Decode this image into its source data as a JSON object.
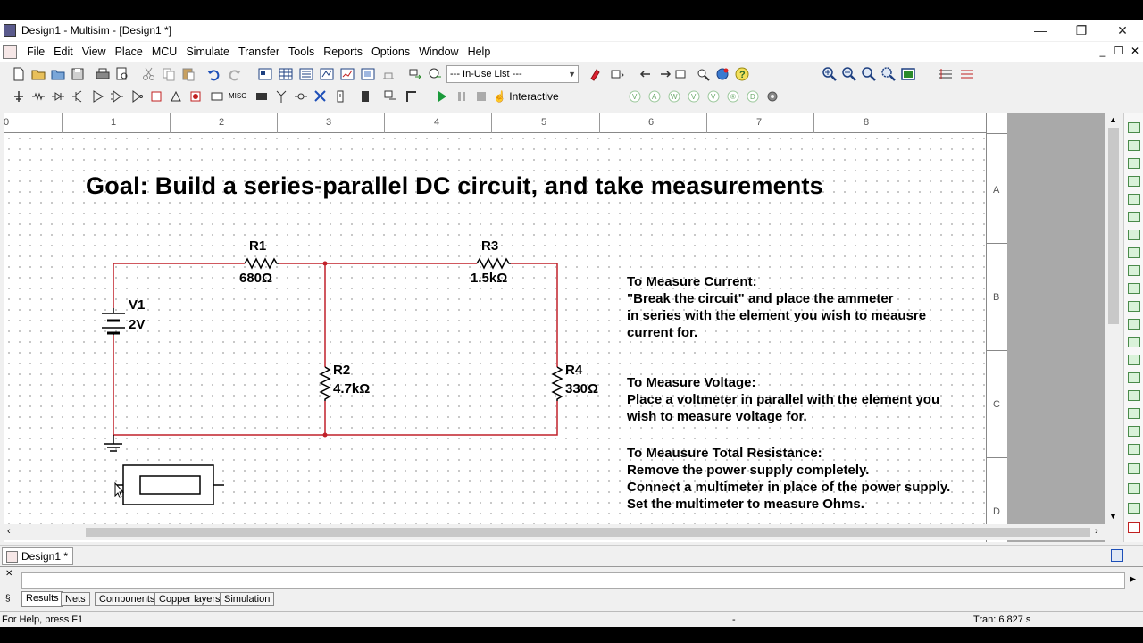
{
  "window": {
    "title": "Design1 - Multisim - [Design1 *]",
    "controls": {
      "minimize": "—",
      "restore": "❐",
      "close": "✕"
    }
  },
  "menu": {
    "items": [
      "File",
      "Edit",
      "View",
      "Place",
      "MCU",
      "Simulate",
      "Transfer",
      "Tools",
      "Reports",
      "Options",
      "Window",
      "Help"
    ],
    "mdi_controls": {
      "minimize": "_",
      "restore": "❐",
      "close": "✕"
    }
  },
  "toolbar": {
    "in_use_list": "--- In-Use List ---",
    "interactive_label": "Interactive",
    "misc_label": "MISC"
  },
  "ruler": {
    "numbers": [
      "0",
      "1",
      "2",
      "3",
      "4",
      "5",
      "6",
      "7",
      "8"
    ]
  },
  "zones": [
    "A",
    "B",
    "C",
    "D"
  ],
  "canvas": {
    "title": "Goal: Build a series-parallel DC circuit, and take measurements",
    "components": {
      "v1_name": "V1",
      "v1_value": "2V",
      "r1_name": "R1",
      "r1_value": "680Ω",
      "r2_name": "R2",
      "r2_value": "4.7kΩ",
      "r3_name": "R3",
      "r3_value": "1.5kΩ",
      "r4_name": "R4",
      "r4_value": "330Ω"
    },
    "notes": {
      "current": {
        "heading": "To Measure Current:",
        "lines": [
          "\"Break the circuit\" and place the ammeter",
          "in series with the element you wish to meausre",
          "current for."
        ]
      },
      "voltage": {
        "heading": "To Measure Voltage:",
        "lines": [
          "Place a voltmeter in parallel with the element you",
          "wish to measure voltage for."
        ]
      },
      "resistance": {
        "heading": "To Meausure Total Resistance:",
        "lines": [
          "Remove the power supply completely.",
          "Connect a multimeter in place of the power supply.",
          "Set the multimeter to measure Ohms."
        ]
      }
    }
  },
  "doc_tab": {
    "label": "Design1 *"
  },
  "bottom_tabs": [
    "Results",
    "Nets",
    "Components",
    "Copper layers",
    "Simulation"
  ],
  "status": {
    "help": "For Help, press F1",
    "middle": "-",
    "tran": "Tran: 6.827 s"
  },
  "colors": {
    "wire": "#c0202a",
    "junction": "#c0202a"
  }
}
